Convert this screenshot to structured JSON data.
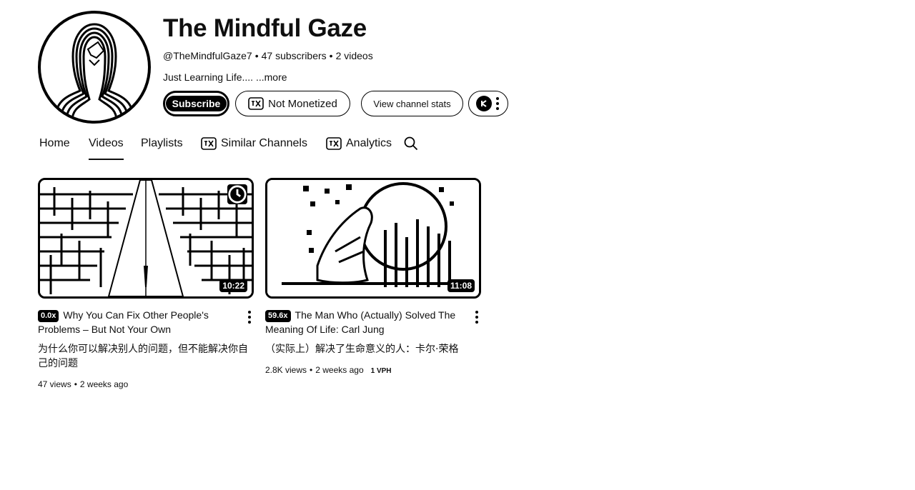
{
  "channel": {
    "title": "The Mindful Gaze",
    "handle": "@TheMindfulGaze7",
    "subscribers": "47 subscribers",
    "videos_count": "2 videos",
    "description": "Just Learning Life....",
    "more_label": "...more"
  },
  "buttons": {
    "subscribe": "Subscribe",
    "monetization": "Not Monetized",
    "stats": "View channel stats"
  },
  "tabs": [
    {
      "label": "Home"
    },
    {
      "label": "Videos",
      "active": true
    },
    {
      "label": "Playlists"
    },
    {
      "label": "Similar Channels",
      "icon": "vidiq-icon"
    },
    {
      "label": "Analytics",
      "icon": "vidiq-icon"
    }
  ],
  "videos": [
    {
      "badge": "0.0x",
      "title": "Why You Can Fix Other People's Problems – But Not Your Own",
      "subtitle": "为什么你可以解决别人的问题，但不能解决你自己的问题",
      "views": "47 views",
      "age": "2 weeks ago",
      "duration": "10:22",
      "thumb_icon": "maze-thumbnail"
    },
    {
      "badge": "59.6x",
      "title": "The Man Who (Actually) Solved The Meaning Of Life: Carl Jung",
      "subtitle": "（实际上）解决了生命意义的人：卡尔·荣格",
      "views": "2.8K views",
      "age": "2 weeks ago",
      "vph": "1 VPH",
      "duration": "11:08",
      "thumb_icon": "meditating-figure-thumbnail"
    }
  ],
  "colors": {
    "ink": "#000000",
    "background": "#ffffff"
  }
}
